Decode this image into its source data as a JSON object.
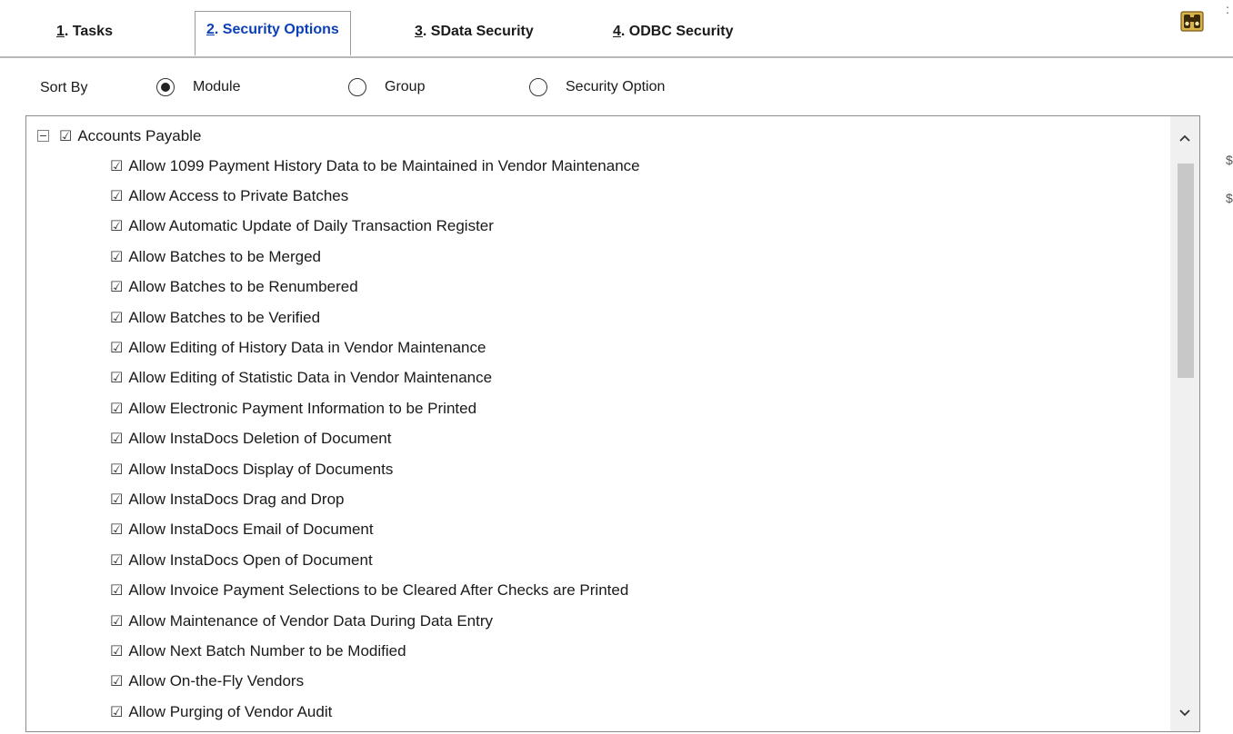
{
  "tabs": [
    {
      "accel": "1",
      "rest": ". Tasks",
      "active": false
    },
    {
      "accel": "2",
      "rest": ". Security Options",
      "active": true
    },
    {
      "accel": "3",
      "rest": ". SData Security",
      "active": false
    },
    {
      "accel": "4",
      "rest": ". ODBC Security",
      "active": false
    }
  ],
  "sort": {
    "label": "Sort By",
    "options": [
      {
        "label": "Module",
        "selected": true
      },
      {
        "label": "Group",
        "selected": false
      },
      {
        "label": "Security Option",
        "selected": false
      }
    ]
  },
  "tree": {
    "root": {
      "label": "Accounts Payable",
      "checked": true,
      "expanded": true
    },
    "checkbox_glyph": "☑",
    "items": [
      "Allow 1099 Payment History Data to be Maintained in Vendor Maintenance",
      "Allow Access to Private Batches",
      "Allow Automatic Update of Daily Transaction Register",
      "Allow Batches to be Merged",
      "Allow Batches to be Renumbered",
      "Allow Batches to be Verified",
      "Allow Editing of History Data in Vendor Maintenance",
      "Allow Editing of Statistic Data in Vendor Maintenance",
      "Allow Electronic Payment Information to be Printed",
      "Allow InstaDocs Deletion of Document",
      "Allow InstaDocs Display of Documents",
      "Allow InstaDocs Drag and Drop",
      "Allow InstaDocs Email of Document",
      "Allow InstaDocs Open of Document",
      "Allow Invoice Payment Selections to be Cleared After Checks are Printed",
      "Allow Maintenance of Vendor Data During Data Entry",
      "Allow Next Batch Number to be Modified",
      "Allow On-the-Fly Vendors",
      "Allow Purging of Vendor Audit"
    ]
  },
  "icons": {
    "help": "binoculars-help-icon",
    "scroll_up": "chevron-up-icon",
    "scroll_down": "chevron-down-icon",
    "collapse": "collapse-minus-icon"
  },
  "colors": {
    "active_tab_text": "#0b3fb8",
    "scroll_thumb": "#c8c8c8",
    "help_icon": "#b8860b"
  }
}
